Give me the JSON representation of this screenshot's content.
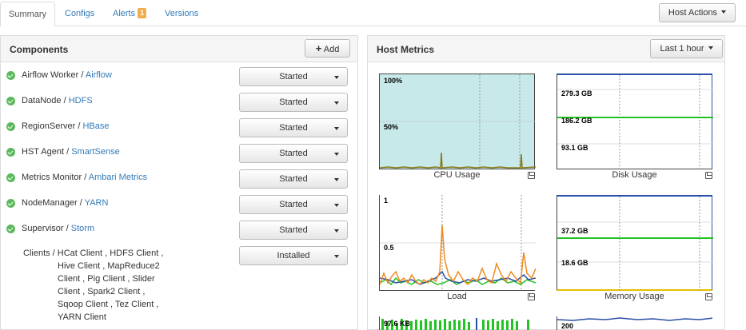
{
  "tabs": [
    {
      "label": "Summary",
      "active": true
    },
    {
      "label": "Configs"
    },
    {
      "label": "Alerts",
      "badge": "1"
    },
    {
      "label": "Versions"
    }
  ],
  "host_actions": "Host Actions",
  "components": {
    "title": "Components",
    "add_label": "Add",
    "rows": [
      {
        "name": "Airflow Worker",
        "service": "Airflow",
        "state": "Started"
      },
      {
        "name": "DataNode",
        "service": "HDFS",
        "state": "Started"
      },
      {
        "name": "RegionServer",
        "service": "HBase",
        "state": "Started"
      },
      {
        "name": "HST Agent",
        "service": "SmartSense",
        "state": "Started"
      },
      {
        "name": "Metrics Monitor",
        "service": "Ambari Metrics",
        "state": "Started"
      },
      {
        "name": "NodeManager",
        "service": "YARN",
        "state": "Started"
      },
      {
        "name": "Supervisor",
        "service": "Storm",
        "state": "Started"
      }
    ],
    "clients": {
      "lines": [
        "Clients / HCat Client , HDFS Client ,",
        "Hive Client , MapReduce2",
        "Client , Pig Client , Slider",
        "Client , Spark2 Client ,",
        "Sqoop Client , Tez Client ,",
        "YARN Client"
      ],
      "state": "Installed"
    },
    "separator": "/"
  },
  "host_metrics": {
    "title": "Host Metrics",
    "range": "Last 1 hour",
    "charts": [
      {
        "title": "CPU Usage",
        "labels": [
          "100%",
          "50%"
        ]
      },
      {
        "title": "Disk Usage",
        "labels": [
          "279.3 GB",
          "186.2 GB",
          "93.1 GB"
        ]
      },
      {
        "title": "Load",
        "labels": [
          "1",
          "0.5"
        ]
      },
      {
        "title": "Memory Usage",
        "labels": [
          "37.2 GB",
          "18.6 GB"
        ]
      },
      {
        "title": "",
        "labels": [
          "97.6 KB"
        ]
      },
      {
        "title": "",
        "labels": [
          "200"
        ]
      }
    ]
  },
  "colors": {
    "link": "#337ab7",
    "ok_icon": "#5cb85c",
    "badge": "#f0ad4e",
    "cpu_fill": "#c7e9ea",
    "series_green": "#22c322",
    "series_blue": "#2a4fa8",
    "series_orange": "#f08a1d"
  }
}
